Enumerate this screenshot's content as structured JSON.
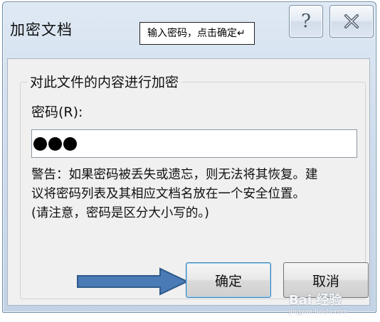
{
  "dialog": {
    "title": "加密文档",
    "help_glyph": "?",
    "group_label": "对此文件的内容进行加密",
    "password_label": "密码(R):",
    "password_dot_count": 3,
    "warning_lines": [
      "警告：如果密码被丢失或遗忘，则无法将其恢复。建",
      "议将密码列表及其相应文档名放在一个安全位置。",
      "(请注意，密码是区分大小写的。)"
    ],
    "ok_label": "确定",
    "cancel_label": "取消"
  },
  "annotation": {
    "callout_text": "输入密码，点击确定↵",
    "arrow_color": "#4a7bb7"
  },
  "watermark": {
    "brand": "Bai 经验",
    "domain": "jingyan.baidu.com"
  }
}
